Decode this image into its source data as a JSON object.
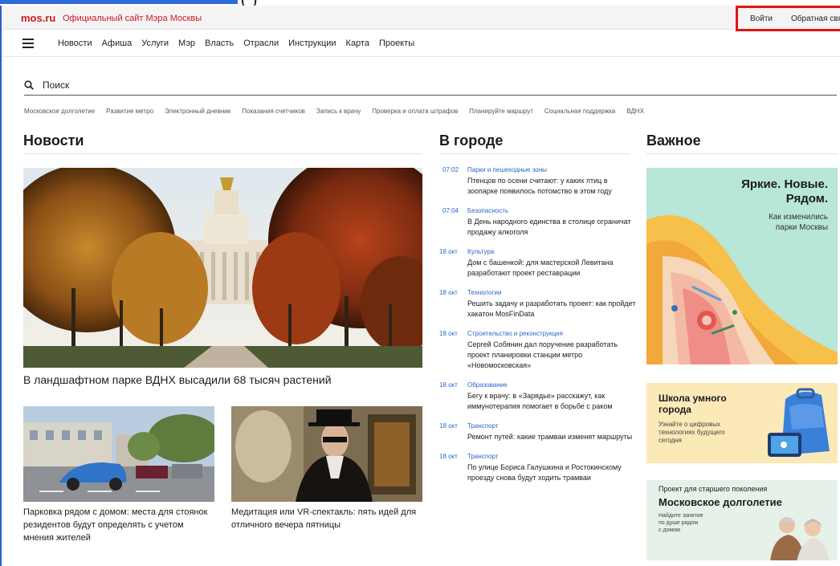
{
  "header": {
    "logo": "mos.ru",
    "site_name": "Официальный сайт Мэра Москвы",
    "login": "Войти",
    "feedback": "Обратная связь"
  },
  "nav": {
    "items": [
      "Новости",
      "Афиша",
      "Услуги",
      "Мэр",
      "Власть",
      "Отрасли",
      "Инструкции",
      "Карта",
      "Проекты"
    ]
  },
  "search": {
    "placeholder": "Поиск"
  },
  "quick_links": [
    "Московское долголетие",
    "Развитие метро",
    "Электронный дневник",
    "Показания счетчиков",
    "Запись к врачу",
    "Проверка и оплата штрафов",
    "Планируйте маршрут",
    "Социальная поддержка",
    "ВДНХ"
  ],
  "news": {
    "title": "Новости",
    "main_caption": "В ландшафтном парке ВДНХ высадили 68 тысяч растений",
    "cards": [
      {
        "caption": "Парковка рядом с домом: места для стоянок резидентов будут определять с учетом мнения жителей"
      },
      {
        "caption": "Медитация или VR-спектакль: пять идей для отличного вечера пятницы"
      }
    ]
  },
  "city": {
    "title": "В городе",
    "items": [
      {
        "time": "07:02",
        "category": "Парки и пешеходные зоны",
        "text": "Птенцов по осени считают: у каких птиц в зоопарке появилось потомство в этом году"
      },
      {
        "time": "07:04",
        "category": "Безопасность",
        "text": "В День народного единства в столице ограничат продажу алкоголя"
      },
      {
        "time": "18 окт",
        "category": "Культура",
        "text": "Дом с башенкой: для мастерской Левитана разработают проект реставрации"
      },
      {
        "time": "18 окт",
        "category": "Технологии",
        "text": "Решить задачу и разработать проект: как пройдет хакатон MosFinData"
      },
      {
        "time": "18 окт",
        "category": "Строительство и реконструкция",
        "text": "Сергей Собянин дал поручение разработать проект планировки станции метро «Новомосковская»"
      },
      {
        "time": "18 окт",
        "category": "Образование",
        "text": "Бегу к врачу: в «Зарядье» расскажут, как иммунотерапия помогает в борьбе с раком"
      },
      {
        "time": "18 окт",
        "category": "Транспорт",
        "text": "Ремонт путей: какие трамваи изменят маршруты"
      },
      {
        "time": "18 окт",
        "category": "Транспорт",
        "text": "По улице Бориса Галушкина и Ростокинскому проезду снова будут ходить трамваи"
      }
    ]
  },
  "important": {
    "title": "Важное",
    "card1": {
      "headline_1": "Яркие. Новые.",
      "headline_2": "Рядом.",
      "sub_1": "Как изменились",
      "sub_2": "парки Москвы"
    },
    "card2": {
      "title_1": "Школа умного",
      "title_2": "города",
      "sub_1": "Узнайте о цифровых",
      "sub_2": "технологиях будущего",
      "sub_3": "сегодня"
    },
    "card3": {
      "kicker": "Проект для старшего поколения",
      "title": "Московское долголетие",
      "sub_1": "Найдите занятие",
      "sub_2": "по душе рядом",
      "sub_3": "с домом"
    }
  },
  "colors": {
    "brand_red": "#cc1a24",
    "link_blue": "#2b67c8",
    "highlight_red": "#e81010"
  }
}
